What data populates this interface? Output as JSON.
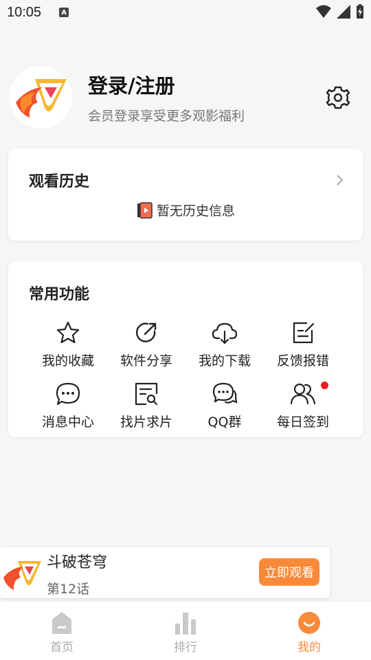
{
  "status": {
    "time": "10:05",
    "indicator": "A"
  },
  "profile": {
    "title": "登录/注册",
    "subtitle": "会员登录享受更多观影福利"
  },
  "history": {
    "title": "观看历史",
    "empty_text": "暂无历史信息"
  },
  "functions": {
    "title": "常用功能",
    "items": [
      {
        "label": "我的收藏",
        "icon": "star-icon"
      },
      {
        "label": "软件分享",
        "icon": "share-icon"
      },
      {
        "label": "我的下载",
        "icon": "cloud-download-icon"
      },
      {
        "label": "反馈报错",
        "icon": "feedback-edit-icon"
      },
      {
        "label": "消息中心",
        "icon": "message-icon"
      },
      {
        "label": "找片求片",
        "icon": "search-document-icon"
      },
      {
        "label": "QQ群",
        "icon": "chat-bubbles-icon"
      },
      {
        "label": "每日签到",
        "icon": "users-icon"
      }
    ]
  },
  "mini_player": {
    "title": "斗破苍穹",
    "episode": "第12话",
    "button": "立即观看"
  },
  "tabs": [
    {
      "label": "首页",
      "icon": "home-icon",
      "active": false
    },
    {
      "label": "排行",
      "icon": "rank-icon",
      "active": false
    },
    {
      "label": "我的",
      "icon": "profile-icon",
      "active": true
    }
  ],
  "colors": {
    "accent": "#f98a3a",
    "badge": "#f01c1c"
  }
}
